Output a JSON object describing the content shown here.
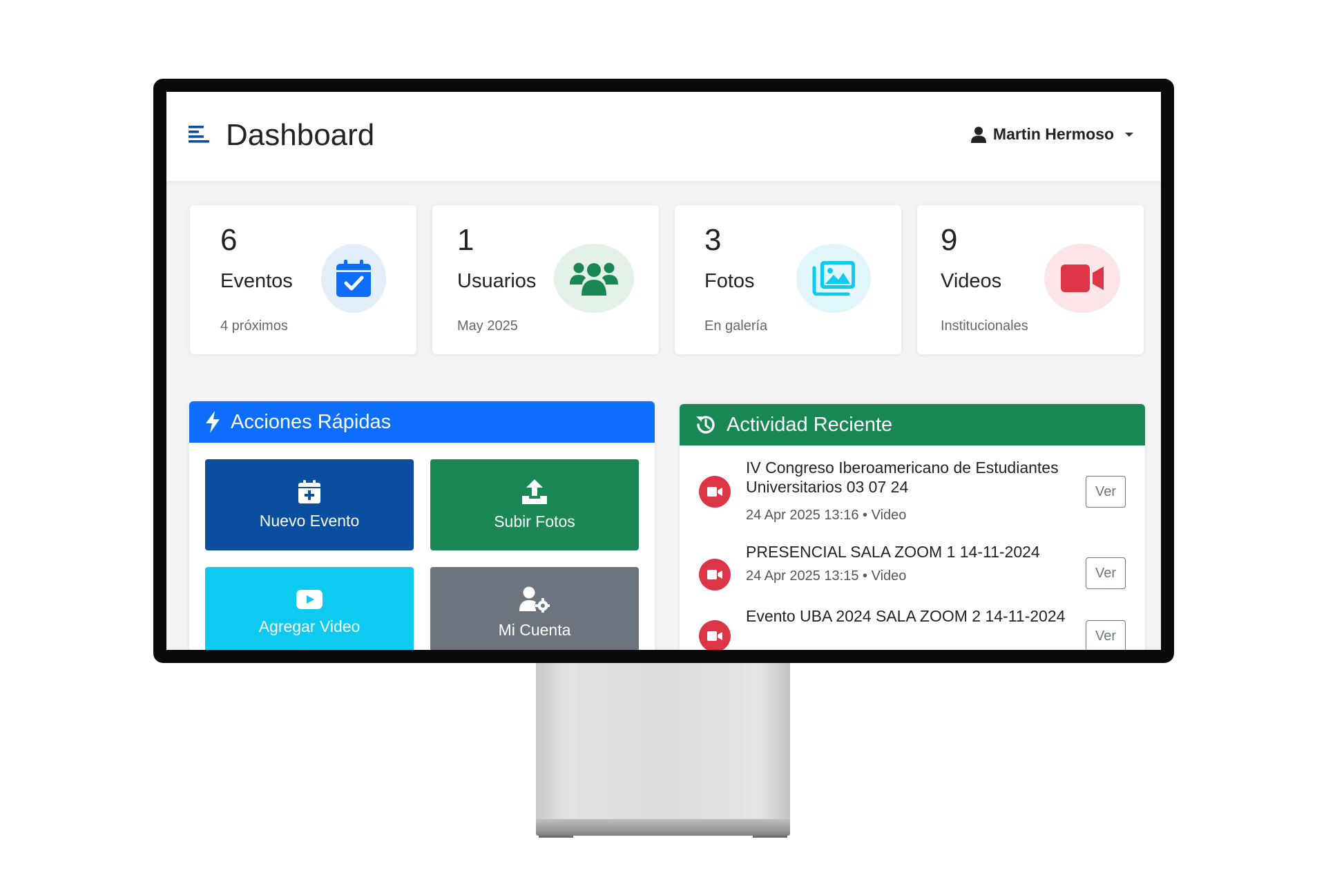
{
  "header": {
    "title": "Dashboard",
    "user_name": "Martin Hermoso"
  },
  "stats": [
    {
      "number": "6",
      "label": "Eventos",
      "sub": "4 próximos",
      "icon": "calendar-check-icon",
      "color": "#0d6efd",
      "bg": "#e3eefb"
    },
    {
      "number": "1",
      "label": "Usuarios",
      "sub": "May 2025",
      "icon": "users-icon",
      "color": "#198754",
      "bg": "#e4f1e8"
    },
    {
      "number": "3",
      "label": "Fotos",
      "sub": "En galería",
      "icon": "images-icon",
      "color": "#0dcaf0",
      "bg": "#e0f6fb"
    },
    {
      "number": "9",
      "label": "Videos",
      "sub": "Institucionales",
      "icon": "video-camera-icon",
      "color": "#dc3545",
      "bg": "#fbe5e8"
    }
  ],
  "quick_actions": {
    "title": "Acciones Rápidas",
    "header_color": "#0d6efd",
    "buttons": [
      {
        "label": "Nuevo Evento",
        "icon": "calendar-plus-icon",
        "color": "#0a4ea0"
      },
      {
        "label": "Subir Fotos",
        "icon": "upload-icon",
        "color": "#1a8754"
      },
      {
        "label": "Agregar Video",
        "icon": "youtube-icon",
        "color": "#0dcaf0"
      },
      {
        "label": "Mi Cuenta",
        "icon": "user-gear-icon",
        "color": "#6c757d"
      }
    ]
  },
  "recent_activity": {
    "title": "Actividad Reciente",
    "header_color": "#198754",
    "button_label": "Ver",
    "items": [
      {
        "title": "IV Congreso Iberoamericano de Estudiantes Universitarios 03 07 24",
        "meta": "24 Apr 2025 13:16 • Video"
      },
      {
        "title": "PRESENCIAL SALA ZOOM 1 14-11-2024",
        "meta": "24 Apr 2025 13:15 • Video"
      },
      {
        "title": "Evento UBA 2024 SALA ZOOM 2 14-11-2024",
        "meta": ""
      }
    ]
  }
}
